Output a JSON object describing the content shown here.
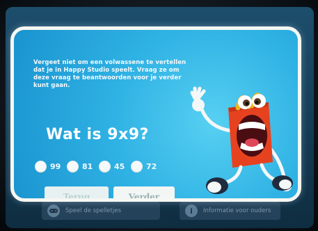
{
  "dialog": {
    "instruction": "Vergeet niet om een volwassene te vertellen dat je in Happy Studio speelt. Vraag ze om deze vraag te beantwoorden voor je verder kunt gaan.",
    "question": "Wat is 9x9?",
    "options": [
      {
        "label": "99"
      },
      {
        "label": "81"
      },
      {
        "label": "45"
      },
      {
        "label": "72"
      }
    ],
    "back_label": "Terug",
    "next_label": "Verder"
  },
  "bottom_nav": {
    "games_label": "Speel de spelletjes",
    "games_icon": "gamepad-icon",
    "parents_label": "Informatie voor ouders",
    "parents_icon": "info-icon"
  },
  "colors": {
    "dialog_bg": "#2fb2e4",
    "mascot_red": "#e7421f",
    "button_bg": "#eef4f3"
  }
}
